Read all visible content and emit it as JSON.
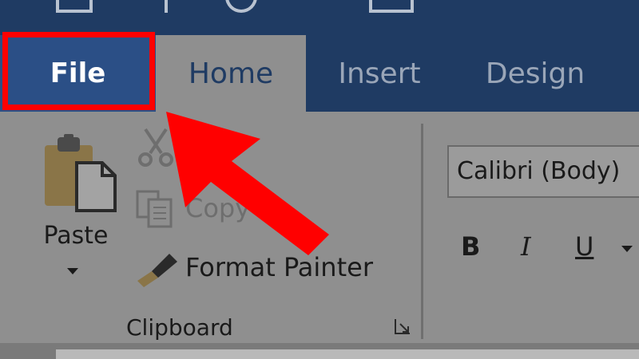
{
  "ribbon": {
    "tabs": {
      "file": "File",
      "home": "Home",
      "insert": "Insert",
      "design": "Design"
    },
    "clipboard": {
      "paste_label": "Paste",
      "copy_label": "Copy",
      "format_painter_label": "Format Painter",
      "group_label": "Clipboard"
    },
    "font": {
      "font_name": "Calibri (Body)",
      "bold": "B",
      "italic": "I",
      "underline": "U"
    }
  },
  "colors": {
    "title_bar": "#1f3b63",
    "file_tab": "#2b4f86",
    "highlight": "#ff0000",
    "ribbon": "#8f8f8f"
  }
}
